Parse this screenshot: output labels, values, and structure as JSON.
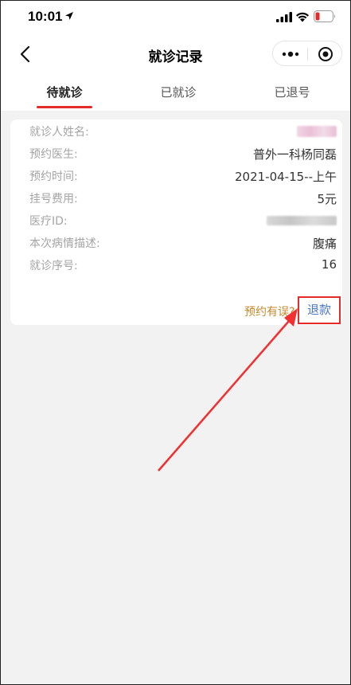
{
  "status_bar": {
    "time": "10:01"
  },
  "nav": {
    "title": "就诊记录"
  },
  "tabs": [
    {
      "label": "待就诊",
      "active": true
    },
    {
      "label": "已就诊",
      "active": false
    },
    {
      "label": "已退号",
      "active": false
    }
  ],
  "record": {
    "rows": [
      {
        "label": "就诊人姓名:",
        "value": ""
      },
      {
        "label": "预约医生:",
        "value": "普外一科杨同磊"
      },
      {
        "label": "预约时间:",
        "value": "2021-04-15--上午"
      },
      {
        "label": "挂号费用:",
        "value": "5元"
      },
      {
        "label": "医疗ID:",
        "value": ""
      },
      {
        "label": "本次病情描述:",
        "value": "腹痛"
      },
      {
        "label": "就诊序号:",
        "value": "16"
      }
    ],
    "footer_question": "预约有误?",
    "refund_label": "退款"
  },
  "colors": {
    "accent_red": "#e52a2a",
    "link_blue": "#4a78c4",
    "warning_orange": "#c5892a"
  }
}
